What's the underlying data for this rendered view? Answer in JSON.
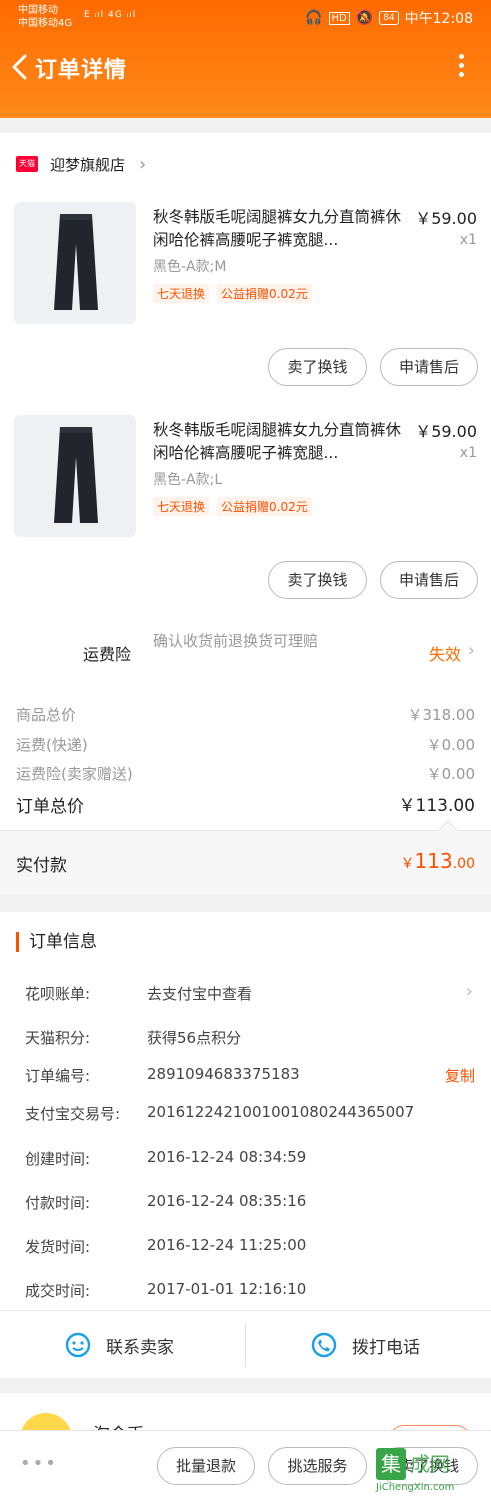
{
  "status_bar": {
    "carrier_1": "中国移动",
    "carrier_2": "中国移动4G",
    "signal": "E ᵢıl 4G ᵢıl",
    "battery": "84",
    "time": "中午12:08"
  },
  "header": {
    "title": "订单详情"
  },
  "shop": {
    "badge": "天猫",
    "name": "迎梦旗舰店"
  },
  "products": [
    {
      "name": "秋冬韩版毛呢阔腿裤女九分直筒裤休闲哈伦裤高腰呢子裤宽腿...",
      "price": "￥59.00",
      "qty": "x1",
      "sku": "黑色-A款;M",
      "tags": [
        "七天退换",
        "公益捐赠0.02元"
      ],
      "btn_sell": "卖了换钱",
      "btn_after_sale": "申请售后"
    },
    {
      "name": "秋冬韩版毛呢阔腿裤女九分直筒裤休闲哈伦裤高腰呢子裤宽腿...",
      "price": "￥59.00",
      "qty": "x1",
      "sku": "黑色-A款;L",
      "tags": [
        "七天退换",
        "公益捐赠0.02元"
      ],
      "btn_sell": "卖了换钱",
      "btn_after_sale": "申请售后"
    }
  ],
  "insurance": {
    "label": "运费险",
    "desc": "确认收货前退换货可理赔",
    "status": "失效"
  },
  "prices": {
    "goods_total_label": "商品总价",
    "goods_total": "￥318.00",
    "shipping_label": "运费(快递)",
    "shipping": "￥0.00",
    "insurance_label": "运费险(卖家赠送)",
    "insurance": "￥0.00",
    "order_total_label": "订单总价",
    "order_total": "￥113.00",
    "paid_label": "实付款",
    "paid_symbol": "￥",
    "paid_int": "113",
    "paid_dec": ".00"
  },
  "order_info": {
    "title": "订单信息",
    "rows": [
      {
        "label": "花呗账单:",
        "value": "去支付宝中查看"
      },
      {
        "label": "天猫积分:",
        "value": "获得56点积分"
      },
      {
        "label": "订单编号:",
        "value": "2891094683375183",
        "action": "复制"
      },
      {
        "label": "支付宝交易号:",
        "value": "2016122421001001080244365007"
      },
      {
        "label": "创建时间:",
        "value": "2016-12-24 08:34:59"
      },
      {
        "label": "付款时间:",
        "value": "2016-12-24 08:35:16"
      },
      {
        "label": "发货时间:",
        "value": "2016-12-24 11:25:00"
      },
      {
        "label": "成交时间:",
        "value": "2017-01-01 12:16:10"
      }
    ]
  },
  "contact": {
    "seller": "联系卖家",
    "phone": "拨打电话"
  },
  "coin": {
    "text": "淘金币"
  },
  "bottom": {
    "more": "•••",
    "batch_refund": "批量退款",
    "select_service": "挑选服务",
    "sell": "卖了换钱"
  },
  "watermark": {
    "mark": "集",
    "text": "成网",
    "url": "JiChengXin.com"
  },
  "colors": {
    "accent": "#ff5000",
    "header_start": "#ff6a00",
    "header_end": "#ff8a1a"
  }
}
